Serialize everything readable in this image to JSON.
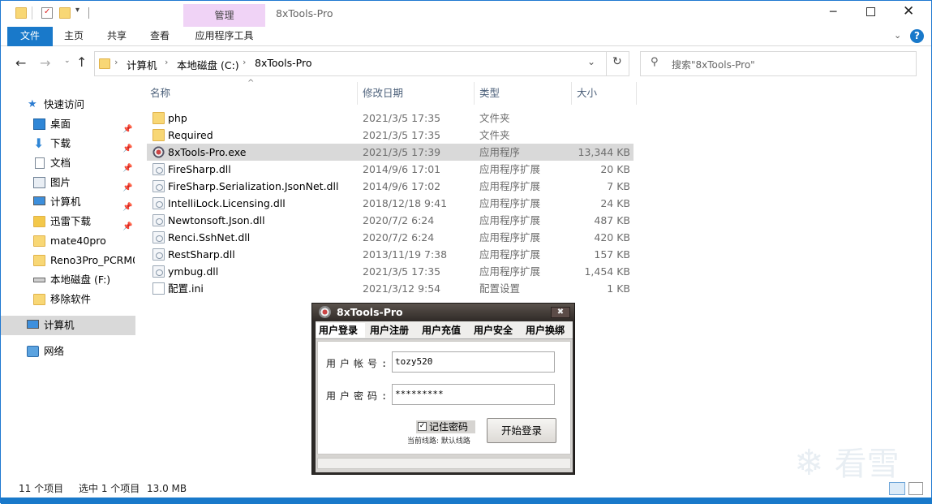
{
  "window": {
    "ribbon_tabs": [
      "文件",
      "主页",
      "共享",
      "查看"
    ],
    "context_group": "管理",
    "context_tab": "应用程序工具",
    "title": "8xTools-Pro"
  },
  "address": {
    "path": [
      "计算机",
      "本地磁盘 (C:)",
      "8xTools-Pro"
    ],
    "search_placeholder": "搜索\"8xTools-Pro\""
  },
  "sidebar": {
    "items": [
      {
        "label": "快速访问",
        "icon": "star-icon",
        "pinned": false
      },
      {
        "label": "桌面",
        "icon": "desktop-icon",
        "pinned": true
      },
      {
        "label": "下载",
        "icon": "download-icon",
        "pinned": true
      },
      {
        "label": "文档",
        "icon": "document-icon",
        "pinned": true
      },
      {
        "label": "图片",
        "icon": "picture-icon",
        "pinned": true
      },
      {
        "label": "计算机",
        "icon": "computer-icon",
        "pinned": true
      },
      {
        "label": "迅雷下载",
        "icon": "folder-icon",
        "pinned": true
      },
      {
        "label": "mate40pro",
        "icon": "folder-icon",
        "pinned": false
      },
      {
        "label": "Reno3Pro_PCRM0",
        "icon": "folder-icon",
        "pinned": false
      },
      {
        "label": "本地磁盘 (F:)",
        "icon": "drive-icon",
        "pinned": false
      },
      {
        "label": "移除软件",
        "icon": "folder-icon",
        "pinned": false
      },
      {
        "label": "计算机",
        "icon": "computer-icon",
        "pinned": false
      },
      {
        "label": "网络",
        "icon": "network-icon",
        "pinned": false
      }
    ]
  },
  "columns": [
    "名称",
    "修改日期",
    "类型",
    "大小"
  ],
  "files": [
    {
      "name": "php",
      "date": "2021/3/5 17:35",
      "type": "文件夹",
      "size": "",
      "icon": "folder-icon"
    },
    {
      "name": "Required",
      "date": "2021/3/5 17:35",
      "type": "文件夹",
      "size": "",
      "icon": "folder-icon"
    },
    {
      "name": "8xTools-Pro.exe",
      "date": "2021/3/5 17:39",
      "type": "应用程序",
      "size": "13,344 KB",
      "icon": "exe-icon"
    },
    {
      "name": "FireSharp.dll",
      "date": "2014/9/6 17:01",
      "type": "应用程序扩展",
      "size": "20 KB",
      "icon": "dll-icon"
    },
    {
      "name": "FireSharp.Serialization.JsonNet.dll",
      "date": "2014/9/6 17:02",
      "type": "应用程序扩展",
      "size": "7 KB",
      "icon": "dll-icon"
    },
    {
      "name": "IntelliLock.Licensing.dll",
      "date": "2018/12/18 9:41",
      "type": "应用程序扩展",
      "size": "24 KB",
      "icon": "dll-icon"
    },
    {
      "name": "Newtonsoft.Json.dll",
      "date": "2020/7/2 6:24",
      "type": "应用程序扩展",
      "size": "487 KB",
      "icon": "dll-icon"
    },
    {
      "name": "Renci.SshNet.dll",
      "date": "2020/7/2 6:24",
      "type": "应用程序扩展",
      "size": "420 KB",
      "icon": "dll-icon"
    },
    {
      "name": "RestSharp.dll",
      "date": "2013/11/19 7:38",
      "type": "应用程序扩展",
      "size": "157 KB",
      "icon": "dll-icon"
    },
    {
      "name": "ymbug.dll",
      "date": "2021/3/5 17:35",
      "type": "应用程序扩展",
      "size": "1,454 KB",
      "icon": "dll-icon"
    },
    {
      "name": "配置.ini",
      "date": "2021/3/12 9:54",
      "type": "配置设置",
      "size": "1 KB",
      "icon": "ini-icon"
    }
  ],
  "status": {
    "count": "11 个项目",
    "selected": "选中 1 个项目",
    "size": "13.0 MB"
  },
  "dialog": {
    "title": "8xTools-Pro",
    "tabs": [
      "用户登录",
      "用户注册",
      "用户充值",
      "用户安全",
      "用户换绑"
    ],
    "account_label": "用户帐号:",
    "account_value": "tozy520",
    "password_label": "用户密码:",
    "password_value": "*********",
    "remember_label": "记住密码",
    "remember_checked": true,
    "line_note": "当前线路: 默认线路",
    "login_button": "开始登录"
  },
  "watermark": "看雪",
  "colors": {
    "accent": "#1979ca",
    "context_tab": "#f0d3f6",
    "selection": "#d9d9d9",
    "dialog_frame": "#2d2a28"
  }
}
